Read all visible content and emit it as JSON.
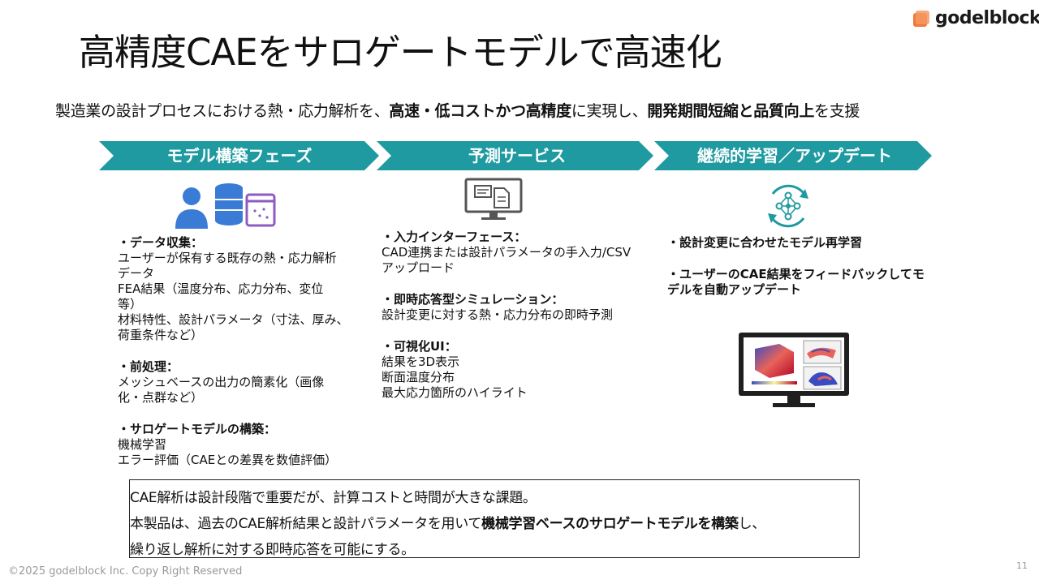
{
  "title": "高精度CAEをサロゲートモデルで高速化",
  "logo": {
    "text": "godelblock",
    "color": "#F07A3B"
  },
  "subtitle": {
    "p1": "製造業の設計プロセスにおける熱・応力解析を、",
    "b1": "高速・低コストかつ高精度",
    "p2": "に実現し、",
    "b2": "開発期間短縮と品質向上",
    "p3": "を支援"
  },
  "accent_color": "#1E9AA0",
  "phases": [
    {
      "label": "モデル構築フェーズ"
    },
    {
      "label": "予測サービス"
    },
    {
      "label": "継続的学習／アップデート"
    }
  ],
  "col1": {
    "sections": [
      {
        "heading": "・データ収集：",
        "lines": [
          "ユーザーが保有する既存の熱・応力解析",
          "データ",
          "FEA結果（温度分布、応力分布、変位",
          "等）",
          "材料特性、設計パラメータ（寸法、厚み、",
          "荷重条件など）"
        ]
      },
      {
        "heading": "・前処理：",
        "lines": [
          "メッシュベースの出力の簡素化（画像",
          "化・点群など）"
        ]
      },
      {
        "heading": "・サロゲートモデルの構築：",
        "lines": [
          "機械学習",
          "エラー評価（CAEとの差異を数値評価）"
        ]
      }
    ]
  },
  "col2": {
    "sections": [
      {
        "heading": "・入力インターフェース：",
        "lines": [
          "CAD連携または設計パラメータの手入力/CSV",
          "アップロード"
        ]
      },
      {
        "heading": "・即時応答型シミュレーション：",
        "lines": [
          "設計変更に対する熱・応力分布の即時予測"
        ]
      },
      {
        "heading": "・可視化UI：",
        "lines": [
          "結果を3D表示",
          "断面温度分布",
          "最大応力箇所のハイライト"
        ]
      }
    ]
  },
  "col3": {
    "items": [
      {
        "line1": "・設計変更に合わせたモデル再学習"
      },
      {
        "line1": "・ユーザーのCAE結果をフィードバックしてモ",
        "line2": "デルを自動アップデート"
      }
    ]
  },
  "box": {
    "line1": "CAE解析は設計段階で重要だが、計算コストと時間が大きな課題。",
    "line2_a": "本製品は、過去のCAE解析結果と設計パラメータを用いて",
    "line2_b": "機械学習ベースのサロゲートモデルを構築",
    "line2_c": "し、",
    "line3": "繰り返し解析に対する即時応答を可能にする。"
  },
  "footer": "©2025 godelblock Inc. Copy Right Reserved",
  "page_number": "11"
}
